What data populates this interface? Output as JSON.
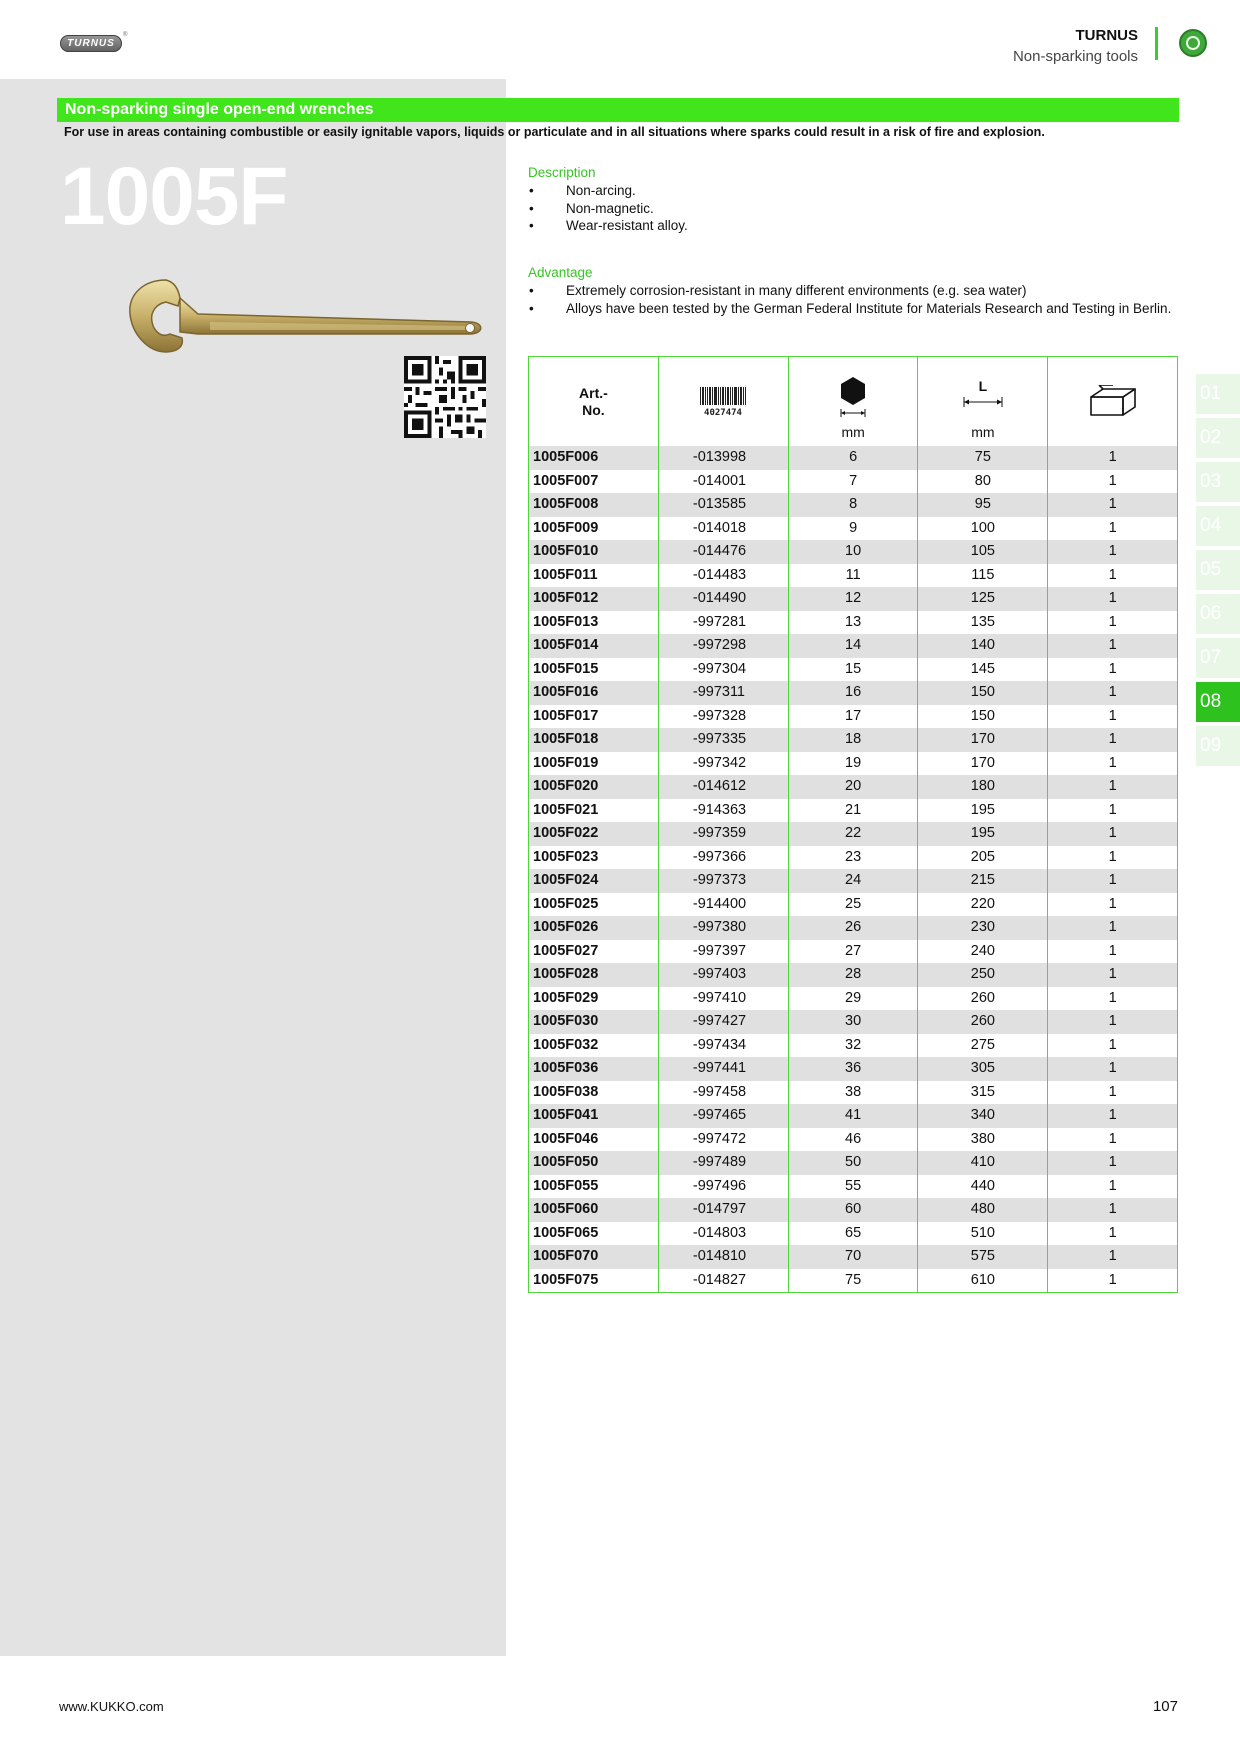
{
  "header": {
    "logo_text": "TURNUS",
    "brand": "TURNUS",
    "subtitle": "Non-sparking tools"
  },
  "title": "Non-sparking single open-end wrenches",
  "intro": "For use in areas containing combustible or easily ignitable vapors, liquids or particulate and in all situations where sparks could result in a risk of fire and explosion.",
  "product_code": "1005F",
  "description": {
    "heading": "Description",
    "items": [
      "Non-arcing.",
      "Non-magnetic.",
      "Wear-resistant alloy."
    ]
  },
  "advantage": {
    "heading": "Advantage",
    "items": [
      "Extremely corrosion-resistant in many different environments (e.g. sea water)",
      "Alloys have been tested by the German Federal Institute for Materials Research and Testing in Berlin."
    ]
  },
  "table": {
    "art_label_1": "Art.-",
    "art_label_2": "No.",
    "barcode_number": "4027474",
    "length_label": "L",
    "unit_size": "mm",
    "unit_length": "mm",
    "rows": [
      [
        "1005F006",
        "-013998",
        "6",
        "75",
        "1"
      ],
      [
        "1005F007",
        "-014001",
        "7",
        "80",
        "1"
      ],
      [
        "1005F008",
        "-013585",
        "8",
        "95",
        "1"
      ],
      [
        "1005F009",
        "-014018",
        "9",
        "100",
        "1"
      ],
      [
        "1005F010",
        "-014476",
        "10",
        "105",
        "1"
      ],
      [
        "1005F011",
        "-014483",
        "11",
        "115",
        "1"
      ],
      [
        "1005F012",
        "-014490",
        "12",
        "125",
        "1"
      ],
      [
        "1005F013",
        "-997281",
        "13",
        "135",
        "1"
      ],
      [
        "1005F014",
        "-997298",
        "14",
        "140",
        "1"
      ],
      [
        "1005F015",
        "-997304",
        "15",
        "145",
        "1"
      ],
      [
        "1005F016",
        "-997311",
        "16",
        "150",
        "1"
      ],
      [
        "1005F017",
        "-997328",
        "17",
        "150",
        "1"
      ],
      [
        "1005F018",
        "-997335",
        "18",
        "170",
        "1"
      ],
      [
        "1005F019",
        "-997342",
        "19",
        "170",
        "1"
      ],
      [
        "1005F020",
        "-014612",
        "20",
        "180",
        "1"
      ],
      [
        "1005F021",
        "-914363",
        "21",
        "195",
        "1"
      ],
      [
        "1005F022",
        "-997359",
        "22",
        "195",
        "1"
      ],
      [
        "1005F023",
        "-997366",
        "23",
        "205",
        "1"
      ],
      [
        "1005F024",
        "-997373",
        "24",
        "215",
        "1"
      ],
      [
        "1005F025",
        "-914400",
        "25",
        "220",
        "1"
      ],
      [
        "1005F026",
        "-997380",
        "26",
        "230",
        "1"
      ],
      [
        "1005F027",
        "-997397",
        "27",
        "240",
        "1"
      ],
      [
        "1005F028",
        "-997403",
        "28",
        "250",
        "1"
      ],
      [
        "1005F029",
        "-997410",
        "29",
        "260",
        "1"
      ],
      [
        "1005F030",
        "-997427",
        "30",
        "260",
        "1"
      ],
      [
        "1005F032",
        "-997434",
        "32",
        "275",
        "1"
      ],
      [
        "1005F036",
        "-997441",
        "36",
        "305",
        "1"
      ],
      [
        "1005F038",
        "-997458",
        "38",
        "315",
        "1"
      ],
      [
        "1005F041",
        "-997465",
        "41",
        "340",
        "1"
      ],
      [
        "1005F046",
        "-997472",
        "46",
        "380",
        "1"
      ],
      [
        "1005F050",
        "-997489",
        "50",
        "410",
        "1"
      ],
      [
        "1005F055",
        "-997496",
        "55",
        "440",
        "1"
      ],
      [
        "1005F060",
        "-014797",
        "60",
        "480",
        "1"
      ],
      [
        "1005F065",
        "-014803",
        "65",
        "510",
        "1"
      ],
      [
        "1005F070",
        "-014810",
        "70",
        "575",
        "1"
      ],
      [
        "1005F075",
        "-014827",
        "75",
        "610",
        "1"
      ]
    ]
  },
  "tabs": [
    {
      "label": "01",
      "active": false
    },
    {
      "label": "02",
      "active": false
    },
    {
      "label": "03",
      "active": false
    },
    {
      "label": "04",
      "active": false
    },
    {
      "label": "05",
      "active": false
    },
    {
      "label": "06",
      "active": false
    },
    {
      "label": "07",
      "active": false
    },
    {
      "label": "08",
      "active": true
    },
    {
      "label": "09",
      "active": false
    }
  ],
  "footer": {
    "url": "www.KUKKO.com",
    "page": "107"
  },
  "colors": {
    "accent_green": "#41e51b",
    "rule_green": "#4fd63a",
    "panel_grey": "#e3e3e3",
    "row_grey": "#e0e0e0"
  },
  "icons": [
    "turnus-logo-badge",
    "kukko-emblem-icon",
    "wrench-image",
    "qr-code",
    "barcode-icon",
    "hexagon-size-icon",
    "length-icon",
    "package-icon"
  ]
}
